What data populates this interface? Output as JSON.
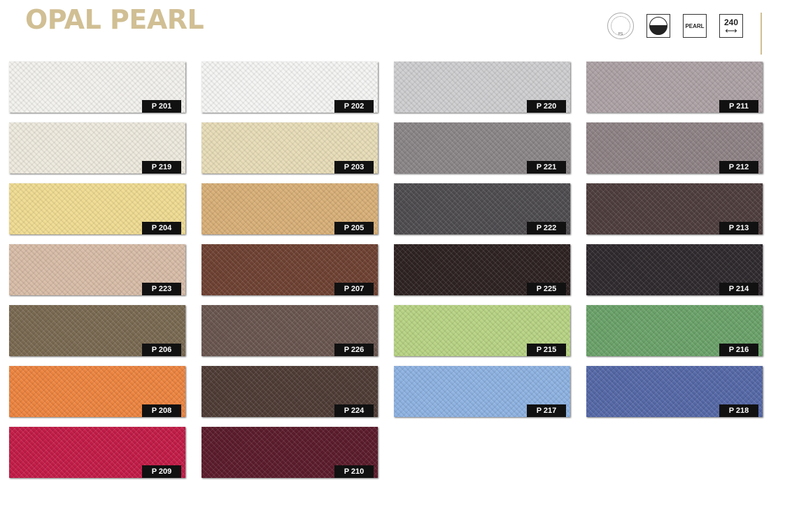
{
  "title": "OPAL PEARL",
  "title_color": "#d1bf94",
  "accent_line_color": "#d1bf94",
  "icons": {
    "cert_text": "PS",
    "pearl_label": "PEARL",
    "width_value": "240",
    "width_arrow": "⟷"
  },
  "swatches": [
    {
      "code": "P 201",
      "color": "#f3f2ee"
    },
    {
      "code": "P 202",
      "color": "#f5f5f4"
    },
    {
      "code": "P 220",
      "color": "#cfced0"
    },
    {
      "code": "P 211",
      "color": "#aea3a6"
    },
    {
      "code": "P 219",
      "color": "#eeeade"
    },
    {
      "code": "P 203",
      "color": "#e8ddb8"
    },
    {
      "code": "P 221",
      "color": "#8b8688"
    },
    {
      "code": "P 212",
      "color": "#8f8386"
    },
    {
      "code": "P 204",
      "color": "#f0dc92"
    },
    {
      "code": "P 205",
      "color": "#d9b078"
    },
    {
      "code": "P 222",
      "color": "#4f4d50"
    },
    {
      "code": "P 213",
      "color": "#4f3e3e"
    },
    {
      "code": "P 223",
      "color": "#d8bda8"
    },
    {
      "code": "P 207",
      "color": "#6f4233"
    },
    {
      "code": "P 225",
      "color": "#2e2322"
    },
    {
      "code": "P 214",
      "color": "#2f2a2e"
    },
    {
      "code": "P 206",
      "color": "#7a6a52"
    },
    {
      "code": "P 226",
      "color": "#6a5650"
    },
    {
      "code": "P 215",
      "color": "#b8d484"
    },
    {
      "code": "P 216",
      "color": "#6ba36a"
    },
    {
      "code": "P 208",
      "color": "#ee8540"
    },
    {
      "code": "P 224",
      "color": "#4f3c36"
    },
    {
      "code": "P 217",
      "color": "#8eb3e2"
    },
    {
      "code": "P 218",
      "color": "#5669a8"
    },
    {
      "code": "P 209",
      "color": "#c41c48"
    },
    {
      "code": "P 210",
      "color": "#5c1c2c"
    }
  ]
}
